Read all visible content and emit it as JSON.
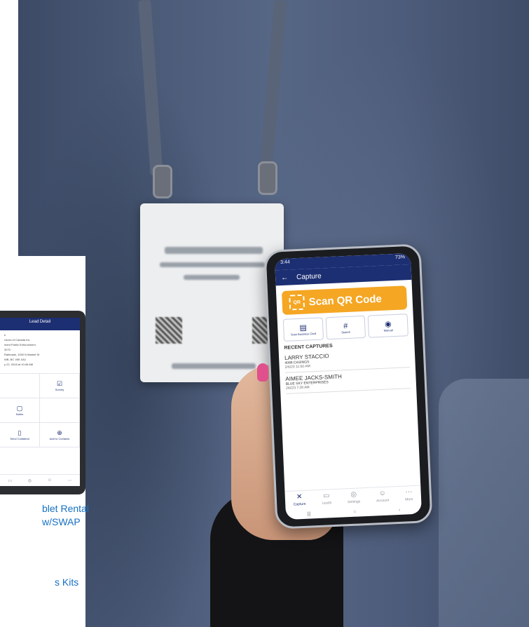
{
  "phone": {
    "status_time": "3:44",
    "status_right": "73%",
    "title": "Capture",
    "scan_label": "Scan QR Code",
    "options": [
      {
        "icon": "business-card-icon",
        "glyph": "▤",
        "label": "Scan Business Card"
      },
      {
        "icon": "hash-icon",
        "glyph": "#",
        "label": "Search"
      },
      {
        "icon": "manual-entry-icon",
        "glyph": "◉",
        "label": "Manual"
      }
    ],
    "recent_label": "RECENT CAPTURES",
    "captures": [
      {
        "name": "LARRY STACCIO",
        "company": "4088 CASINGS",
        "time": "2/6/23 11:50 AM"
      },
      {
        "name": "AIMEE JACKS-SMITH",
        "company": "BLUE SKY ENTERPRISES",
        "time": "2/6/23 7:28 AM"
      }
    ],
    "nav": [
      {
        "icon": "capture-icon",
        "glyph": "✕",
        "label": "Capture"
      },
      {
        "icon": "leads-icon",
        "glyph": "▭",
        "label": "Leads"
      },
      {
        "icon": "settings-icon",
        "glyph": "◎",
        "label": "Settings"
      },
      {
        "icon": "account-icon",
        "glyph": "☺",
        "label": "Account"
      },
      {
        "icon": "more-icon",
        "glyph": "⋯",
        "label": "More"
      }
    ],
    "system_nav": [
      "|||",
      "○",
      "‹"
    ]
  },
  "tablet": {
    "title": "Lead Detail",
    "lines": [
      "e",
      "rvices of Canada Inc",
      "ment Public Enforcement",
      "",
      "3270",
      "",
      "Railroads, 1000 N Market St",
      "WB, BC V5K 0A1",
      "",
      "y 22, 2018 at 10:46 AM"
    ],
    "actions": [
      {
        "icon": "blank-icon",
        "glyph": "",
        "label": ""
      },
      {
        "icon": "survey-icon",
        "glyph": "☑",
        "label": "Survey"
      },
      {
        "icon": "notes-icon",
        "glyph": "▢",
        "label": "Notes"
      },
      {
        "icon": "blank-icon",
        "glyph": "",
        "label": ""
      },
      {
        "icon": "collateral-icon",
        "glyph": "▯",
        "label": "Send Collateral"
      },
      {
        "icon": "add-contacts-icon",
        "glyph": "⊕",
        "label": "Add to Contacts"
      }
    ]
  },
  "links": {
    "line1": "blet Rental",
    "line2": "w/SWAP",
    "line3": "s Kits"
  }
}
